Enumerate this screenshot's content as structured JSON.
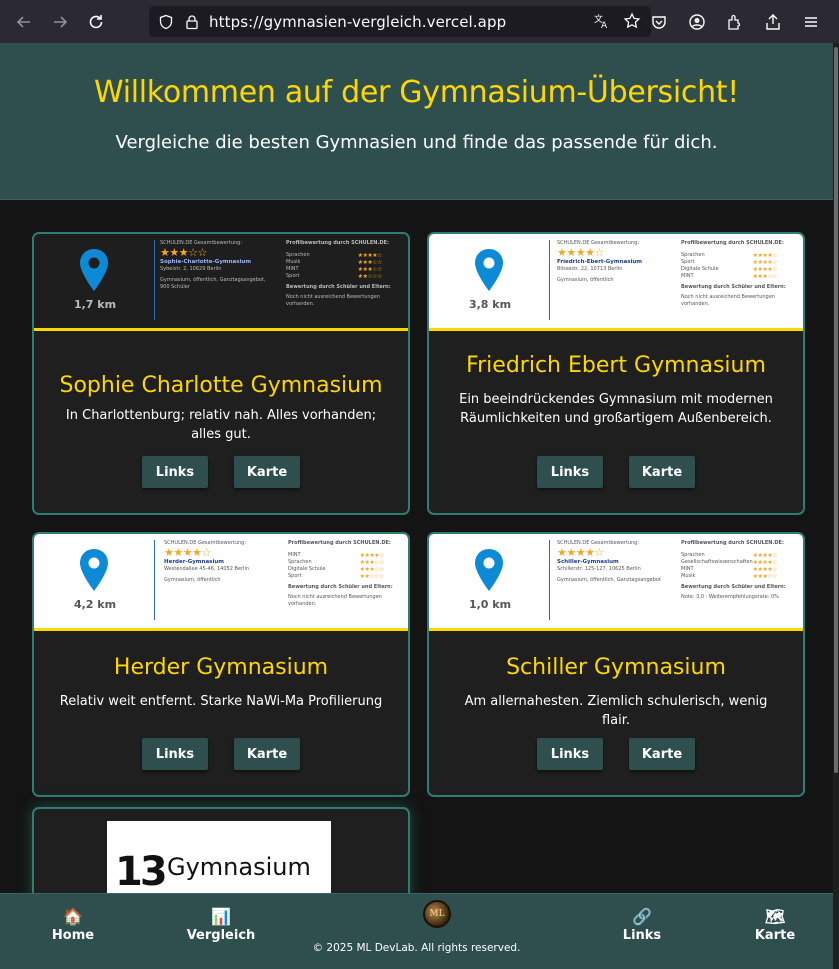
{
  "browser": {
    "url": "https://gymnasien-vergleich.vercel.app"
  },
  "hero": {
    "title": "Willkommen auf der Gymnasium-Übersicht!",
    "subtitle": "Vergleiche die besten Gymnasien und finde das passende für dich."
  },
  "cards": [
    {
      "name": "Sophie Charlotte Gymnasium",
      "description": "In Charlottenburg; relativ nah. Alles vorhanden; alles gut.",
      "distance": "1,7 km",
      "preview_rating_label": "SCHULEN.DE Gesamtbewertung:",
      "preview_school": "Sophie-Charlotte-Gymnasium",
      "preview_address": "Sybelstr. 2, 10629 Berlin",
      "preview_type": "Gymnasium, öffentlich, Ganztagsangebot, 900 Schüler",
      "preview_profile_title": "Profilbewertung durch SCHULEN.DE:",
      "preview_profile": [
        "Sprachen",
        "Musik",
        "MINT",
        "Sport"
      ],
      "preview_feedback": "Bewertung durch Schüler und Eltern:",
      "preview_feedback_note": "Noch nicht ausreichend Bewertungen vorhanden.",
      "links_label": "Links",
      "map_label": "Karte"
    },
    {
      "name": "Friedrich Ebert Gymnasium",
      "description": "Ein beeindrückendes Gymnasium mit modernen Räumlichkeiten und großartigem Außenbereich.",
      "distance": "3,8 km",
      "preview_rating_label": "SCHULEN.DE Gesamtbewertung:",
      "preview_school": "Friedrich-Ebert-Gymnasium",
      "preview_address": "Blissestr. 22, 10713 Berlin",
      "preview_type": "Gymnasium, öffentlich",
      "preview_profile_title": "Profilbewertung durch SCHULEN.DE:",
      "preview_profile": [
        "Sprachen",
        "Sport",
        "Digitale Schule",
        "MINT"
      ],
      "preview_feedback": "Bewertung durch Schüler und Eltern:",
      "preview_feedback_note": "Noch nicht ausreichend Bewertungen vorhanden.",
      "links_label": "Links",
      "map_label": "Karte"
    },
    {
      "name": "Herder Gymnasium",
      "description": "Relativ weit entfernt. Starke NaWi-Ma Profilierung",
      "distance": "4,2 km",
      "preview_rating_label": "SCHULEN.DE Gesamtbewertung:",
      "preview_school": "Herder-Gymnasium",
      "preview_address": "Westendallee 45-46, 14052 Berlin",
      "preview_type": "Gymnasium, öffentlich",
      "preview_profile_title": "Profilbewertung durch SCHULEN.DE:",
      "preview_profile": [
        "MINT",
        "Sprachen",
        "Digitale Schule",
        "Sport"
      ],
      "preview_feedback": "Bewertung durch Schüler und Eltern:",
      "preview_feedback_note": "Noch nicht ausreichend Bewertungen vorhanden.",
      "links_label": "Links",
      "map_label": "Karte"
    },
    {
      "name": "Schiller Gymnasium",
      "description": "Am allernahesten. Ziemlich schulerisch, wenig flair.",
      "distance": "1,0 km",
      "preview_rating_label": "SCHULEN.DE Gesamtbewertung:",
      "preview_school": "Schiller-Gymnasium",
      "preview_address": "Schillerstr. 125-127, 10625 Berlin",
      "preview_type": "Gymnasium, öffentlich, Ganztagsangebot",
      "preview_profile_title": "Profilbewertung durch SCHULEN.DE:",
      "preview_profile": [
        "Sprachen",
        "Gesellschaftswissenschaften",
        "MINT",
        "Musik"
      ],
      "preview_feedback": "Bewertung durch Schüler und Eltern:",
      "preview_feedback_note": "Note: 3,0 · Weiterempfehlungsrate: 0%",
      "links_label": "Links",
      "map_label": "Karte"
    },
    {
      "logo_number": "13",
      "logo_word": "Gymnasium"
    }
  ],
  "footer": {
    "home": "Home",
    "compare": "Vergleich",
    "links": "Links",
    "map": "Karte",
    "badge": "ML",
    "copyright": "© 2025 ML DevLab. All rights reserved."
  },
  "colors": {
    "accent": "#ffd700",
    "header_bg": "#2f4f4f",
    "card_border": "#2f7d72",
    "pin": "#0d8ad6"
  }
}
